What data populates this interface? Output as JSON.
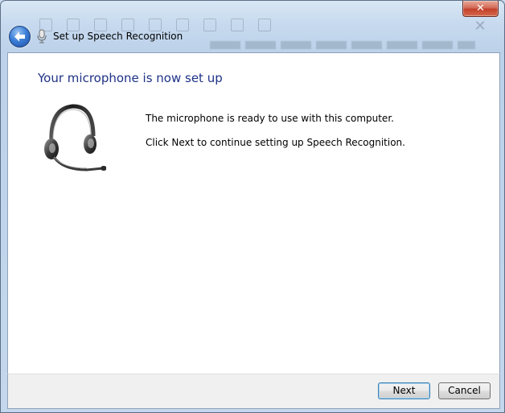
{
  "window": {
    "title": "Set up Speech Recognition",
    "close_label": "✕"
  },
  "page": {
    "heading": "Your microphone is now set up",
    "message_ready": "The microphone is ready to use with this computer.",
    "message_next": "Click Next to continue setting up Speech Recognition."
  },
  "buttons": {
    "next_label": "Next",
    "cancel_label": "Cancel"
  },
  "icons": {
    "back": "back-arrow-icon",
    "title": "microphone-icon",
    "illustration": "headset-icon",
    "close": "close-icon"
  },
  "colors": {
    "heading": "#1e3287",
    "close_button": "#c3402a",
    "back_button": "#3d7fd8"
  }
}
